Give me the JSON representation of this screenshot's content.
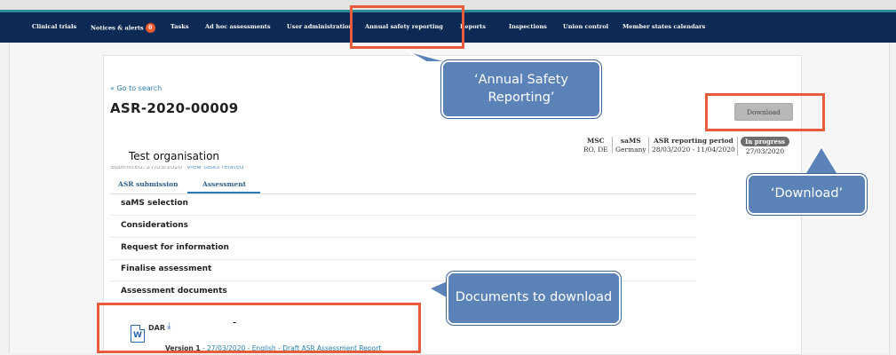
{
  "nav": {
    "items": [
      "Clinical trials",
      "Notices & alerts",
      "Tasks",
      "Ad hoc assessments",
      "User administration",
      "Annual safety reporting",
      "Reports",
      "Inspections",
      "Union control",
      "Member states calendars"
    ],
    "alerts_count": "0"
  },
  "header": {
    "back_link": "« Go to search",
    "asr_id": "ASR-2020-00009",
    "download_label": "Download",
    "org_name": "Test organisation",
    "submitted_text": "Submitted: 27/03/2020",
    "view_tasks_link": "View tasks related"
  },
  "meta": {
    "msc_label": "MSC",
    "msc_value": "RO, DE",
    "sams_label": "saMS",
    "sams_value": "Germany",
    "period_label": "ASR reporting period",
    "period_value": "28/03/2020 - 11/04/2020",
    "status_badge": "In progress",
    "status_date": "27/03/2020"
  },
  "tabs": [
    "ASR submission",
    "Assessment"
  ],
  "sections": [
    "saMS selection",
    "Considerations",
    "Request for information",
    "Finalise assessment",
    "Assessment documents"
  ],
  "document": {
    "icon_letter": "W",
    "name": "DAR",
    "dash": "-",
    "version_label": "Version 1",
    "version_details": " - 27/03/2020 - English - Draft ASR Assessment Report"
  },
  "callouts": {
    "annual": "‘Annual Safety Reporting’",
    "download": "‘Download’",
    "documents": "Documents to download"
  },
  "colors": {
    "nav_bg": "#0c2a53",
    "highlight": "#e85c3c",
    "callout_bg": "#5b83b8",
    "link": "#2a7fb0"
  }
}
